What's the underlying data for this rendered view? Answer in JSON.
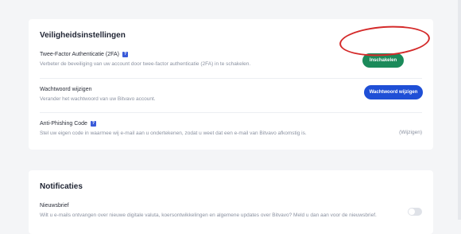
{
  "security": {
    "title": "Veiligheidsinstellingen",
    "two_factor": {
      "title": "Twee-Factor Authenticatie (2FA)",
      "description": "Verbeter de beveiliging van uw account door twee-factor authenticatie (2FA) in te schakelen.",
      "button_label": "Inschakelen",
      "help_glyph": "?"
    },
    "password": {
      "title": "Wachtwoord wijzigen",
      "description": "Verander het wachtwoord van uw Bitvavo account.",
      "button_label": "Wachtwoord wijzigen"
    },
    "anti_phishing": {
      "title": "Anti-Phishing Code",
      "description": "Stel uw eigen code in waarmee wij e-mail aan u ondertekenen, zodat u weet dat een e-mail van Bitvavo afkomstig is.",
      "link_label": "(Wijzigen)",
      "help_glyph": "?"
    }
  },
  "notifications": {
    "title": "Notificaties",
    "newsletter": {
      "title": "Nieuwsbrief",
      "description": "Wilt u e-mails ontvangen over nieuwe digitale valuta, koersontwikkelingen en algemene updates over Bitvavo? Meld u dan aan voor de nieuwsbrief.",
      "enabled": false
    }
  },
  "colors": {
    "enable_button": "#1b8a5a",
    "change_button": "#1f4fd6",
    "annotation_ring": "#d42a2a"
  }
}
